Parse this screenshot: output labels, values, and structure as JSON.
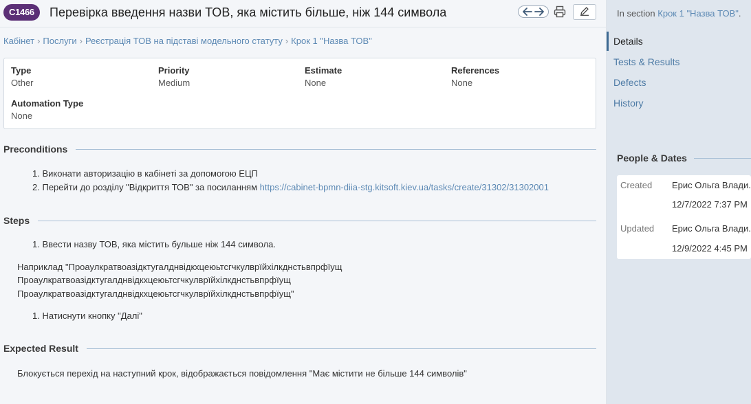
{
  "header": {
    "case_id": "C1466",
    "title": "Перевірка введення назви ТОВ, яка містить більше, ніж 144 символа"
  },
  "breadcrumb": [
    "Кабінет",
    "Послуги",
    "Реєстрація ТОВ на підставі модельного статуту",
    "Крок 1 \"Назва ТОВ\""
  ],
  "fields": {
    "type": {
      "label": "Type",
      "value": "Other"
    },
    "priority": {
      "label": "Priority",
      "value": "Medium"
    },
    "estimate": {
      "label": "Estimate",
      "value": "None"
    },
    "references": {
      "label": "References",
      "value": "None"
    },
    "automation_type": {
      "label": "Automation Type",
      "value": "None"
    }
  },
  "preconditions": {
    "title": "Preconditions",
    "items": [
      {
        "num": "1.",
        "text": "Виконати авторизацію в кабінеті за допомогою ЕЦП"
      },
      {
        "num": "2.",
        "text": "Перейти до розділу \"Відкриття ТОВ\" за посиланням ",
        "link": "https://cabinet-bpmn-diia-stg.kitsoft.kiev.ua/tasks/create/31302/31302001"
      }
    ]
  },
  "steps": {
    "title": "Steps",
    "item1": {
      "num": "1.",
      "text": "Ввести назву ТОВ, яка містить бульше ніж 144 символа."
    },
    "example_lines": [
      "Наприклад \"Проаулкратвоазідктугалднвідкхцеюьтсгчкулврїйхілкднстьвпрфїущ",
      "Проаулкратвоазідктугалднвідкхцеюьтсгчкулврїйхілкднстьвпрфїущ",
      "Проаулкратвоазідктугалднвідкхцеюьтсгчкулврїйхілкднстьвпрфїущ\""
    ],
    "item2": {
      "num": "1.",
      "text": "Натиснути кнопку \"Далі\""
    }
  },
  "expected": {
    "title": "Expected Result",
    "text": "Блокується перехід на наступний крок, відображається повідомлення \"Має містити не більше 144 символів\""
  },
  "sidebar": {
    "in_section_prefix": "In section ",
    "in_section_link": "Крок 1 \"Назва ТОВ\"",
    "in_section_suffix": ".",
    "tabs": [
      "Details",
      "Tests & Results",
      "Defects",
      "History"
    ],
    "people_title": "People & Dates",
    "created_label": "Created",
    "created_by": "Ерис Ольга Влади...",
    "created_at": "12/7/2022 7:37 PM",
    "updated_label": "Updated",
    "updated_by": "Ерис Ольга Влади...",
    "updated_at": "12/9/2022 4:45 PM"
  },
  "colors": {
    "badge": "#5b2f76",
    "link": "#5c89b4",
    "sidebar_bg": "#dfe6ee"
  }
}
